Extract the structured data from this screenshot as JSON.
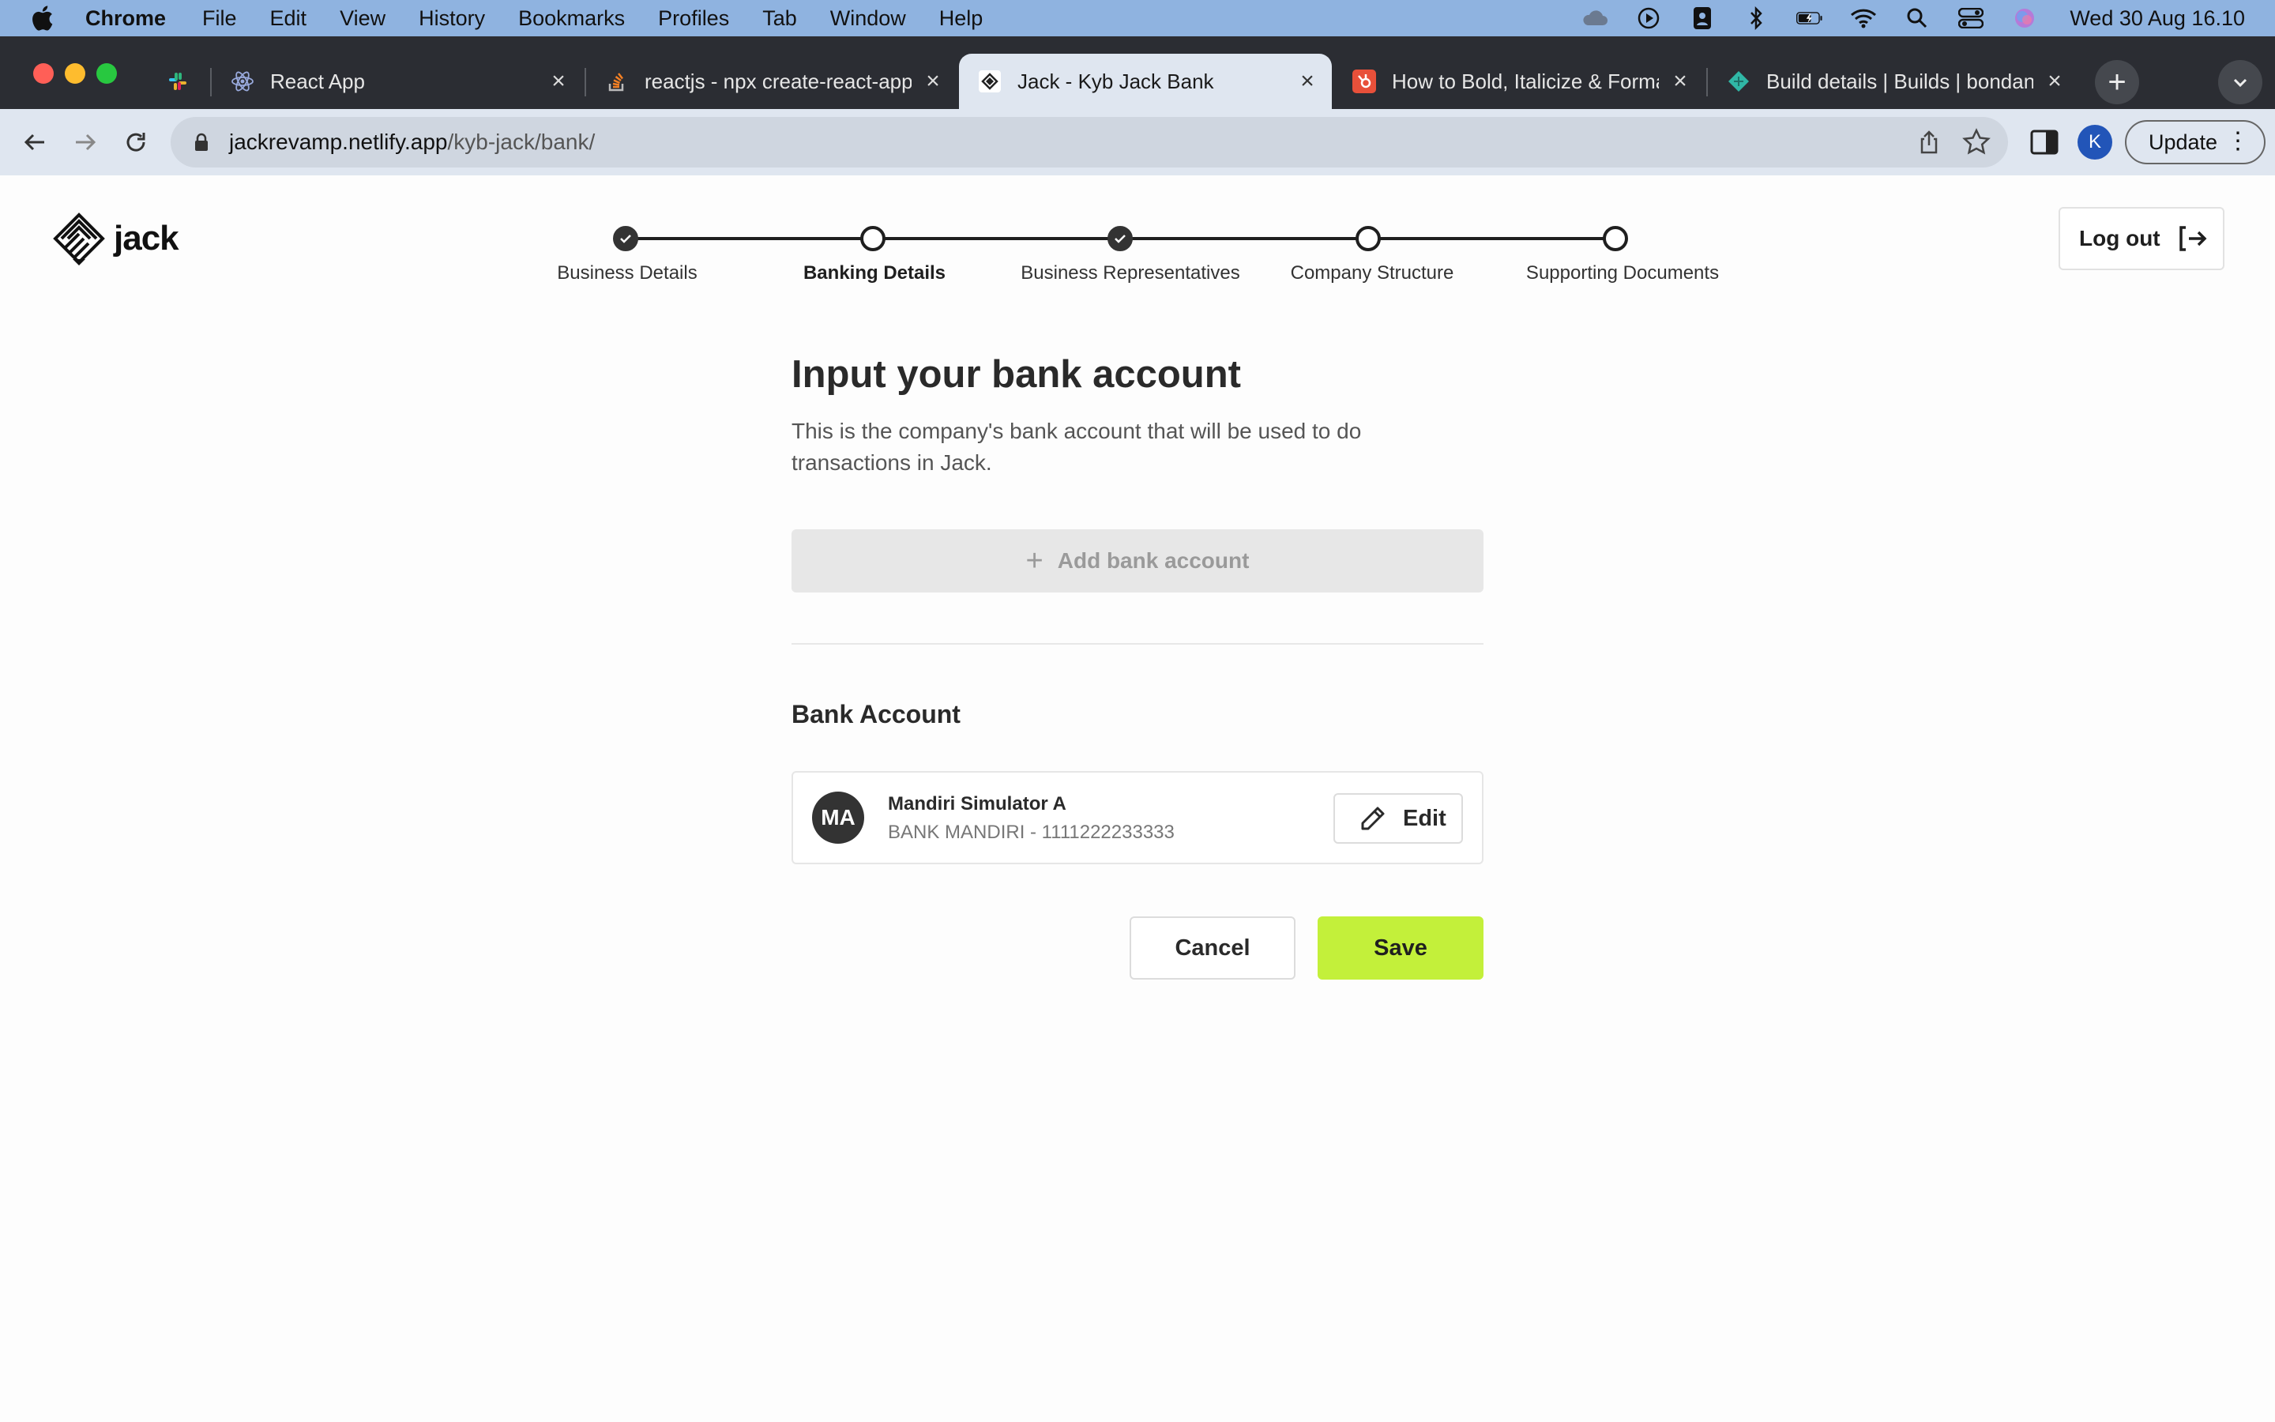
{
  "menubar": {
    "app_name": "Chrome",
    "items": [
      "File",
      "Edit",
      "View",
      "History",
      "Bookmarks",
      "Profiles",
      "Tab",
      "Window",
      "Help"
    ],
    "clock": "Wed 30 Aug  16.10"
  },
  "tabs": [
    {
      "title": "",
      "icon": "slack-icon"
    },
    {
      "title": "React App",
      "icon": "react-icon"
    },
    {
      "title": "reactjs - npx create-react-app",
      "icon": "stackoverflow-icon"
    },
    {
      "title": "Jack - Kyb Jack Bank",
      "icon": "jack-icon",
      "active": true
    },
    {
      "title": "How to Bold, Italicize & Format",
      "icon": "hubspot-icon"
    },
    {
      "title": "Build details | Builds | bondan-",
      "icon": "netlify-icon"
    }
  ],
  "toolbar": {
    "url_host": "jackrevamp.netlify.app",
    "url_path": "/kyb-jack/bank/",
    "profile_initial": "K",
    "update_label": "Update"
  },
  "brand": {
    "name": "jack"
  },
  "stepper": {
    "steps": [
      {
        "label": "Business Details",
        "status": "done"
      },
      {
        "label": "Banking Details",
        "status": "current"
      },
      {
        "label": "Business Representatives",
        "status": "done"
      },
      {
        "label": "Company Structure",
        "status": "pending"
      },
      {
        "label": "Supporting Documents",
        "status": "pending"
      }
    ]
  },
  "logout_label": "Log out",
  "main": {
    "heading": "Input your bank account",
    "subtitle": "This is the company's bank account that will be used to do transactions in Jack.",
    "add_button": "Add bank account",
    "section_title": "Bank Account",
    "account": {
      "initials": "MA",
      "name": "Mandiri Simulator A",
      "detail": "BANK MANDIRI - 1111222233333",
      "edit_label": "Edit"
    },
    "cancel_label": "Cancel",
    "save_label": "Save"
  },
  "colors": {
    "accent": "#c3f03a",
    "dark": "#333333",
    "menubar": "#8fb3e0",
    "tabstrip": "#2b2d33"
  }
}
